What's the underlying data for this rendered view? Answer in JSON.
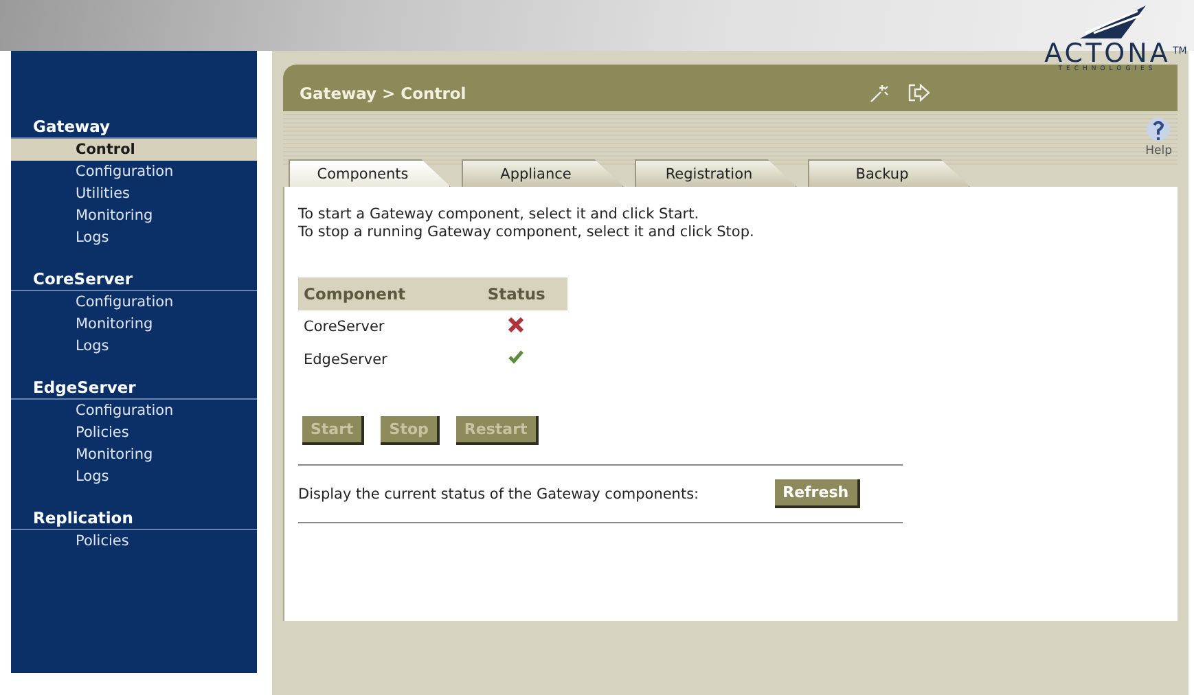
{
  "logo": {
    "name": "ACTONA",
    "trademark": "TM",
    "tagline": "TECHNOLOGIES"
  },
  "sidebar": {
    "sections": [
      {
        "label": "Gateway",
        "items": [
          {
            "label": "Control",
            "selected": true
          },
          {
            "label": "Configuration",
            "selected": false
          },
          {
            "label": "Utilities",
            "selected": false
          },
          {
            "label": "Monitoring",
            "selected": false
          },
          {
            "label": "Logs",
            "selected": false
          }
        ]
      },
      {
        "label": "CoreServer",
        "items": [
          {
            "label": "Configuration",
            "selected": false
          },
          {
            "label": "Monitoring",
            "selected": false
          },
          {
            "label": "Logs",
            "selected": false
          }
        ]
      },
      {
        "label": "EdgeServer",
        "items": [
          {
            "label": "Configuration",
            "selected": false
          },
          {
            "label": "Policies",
            "selected": false
          },
          {
            "label": "Monitoring",
            "selected": false
          },
          {
            "label": "Logs",
            "selected": false
          }
        ]
      },
      {
        "label": "Replication",
        "items": [
          {
            "label": "Policies",
            "selected": false
          }
        ]
      }
    ]
  },
  "breadcrumb": "Gateway > Control",
  "help": {
    "label": "Help"
  },
  "tabs": [
    {
      "label": "Components",
      "selected": true
    },
    {
      "label": "Appliance",
      "selected": false
    },
    {
      "label": "Registration",
      "selected": false
    },
    {
      "label": "Backup",
      "selected": false
    }
  ],
  "instructions": [
    "To start a Gateway component, select it and click Start.",
    "To stop a running Gateway component, select it and click Stop."
  ],
  "table": {
    "columns": [
      "Component",
      "Status"
    ],
    "rows": [
      {
        "component": "CoreServer",
        "running": false
      },
      {
        "component": "EdgeServer",
        "running": true
      }
    ]
  },
  "actions": [
    {
      "label": "Start",
      "disabled": true
    },
    {
      "label": "Stop",
      "disabled": true
    },
    {
      "label": "Restart",
      "disabled": true
    }
  ],
  "refresh": {
    "text": "Display the current status of the Gateway components:",
    "button": {
      "label": "Refresh",
      "disabled": false
    }
  }
}
